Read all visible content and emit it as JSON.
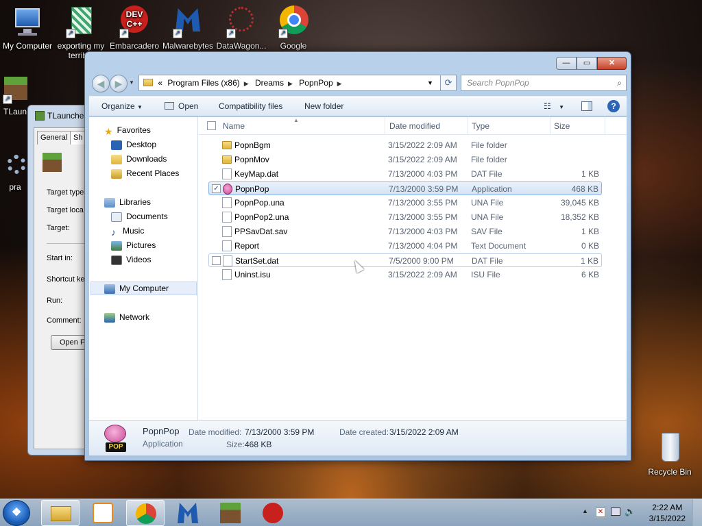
{
  "desktop": {
    "icons": [
      {
        "label": "My Computer"
      },
      {
        "label": "exporting my terrible"
      },
      {
        "label": "Embarcadero"
      },
      {
        "label": "Malwarebytes"
      },
      {
        "label": "DataWagon..."
      },
      {
        "label": "Google"
      },
      {
        "label": "TLaun"
      },
      {
        "label": "pra"
      }
    ],
    "recycle_bin": "Recycle Bin",
    "dev_badge": "DEV",
    "cpp_badge": "C++"
  },
  "bg_window": {
    "title": "TLaunche",
    "tab_general": "General",
    "tab_sh": "Sh",
    "fields": [
      "Target type",
      "Target loca",
      "Target:",
      "Start in:",
      "Shortcut ke",
      "Run:",
      "Comment:"
    ],
    "open_button": "Open F"
  },
  "explorer": {
    "caption": {
      "minimize": "—",
      "maximize": "▭",
      "close": "✕"
    },
    "address": {
      "overflow": "«",
      "crumbs": [
        "Program Files (x86)",
        "Dreams",
        "PopnPop"
      ]
    },
    "search_placeholder": "Search PopnPop",
    "toolbar": {
      "organize": "Organize",
      "open": "Open",
      "compat": "Compatibility files",
      "new_folder": "New folder"
    },
    "nav": {
      "favorites": "Favorites",
      "desktop": "Desktop",
      "downloads": "Downloads",
      "recent": "Recent Places",
      "libraries": "Libraries",
      "documents": "Documents",
      "music": "Music",
      "pictures": "Pictures",
      "videos": "Videos",
      "computer": "My Computer",
      "network": "Network"
    },
    "columns": {
      "name": "Name",
      "date": "Date modified",
      "type": "Type",
      "size": "Size"
    },
    "files": [
      {
        "name": "PopnBgm",
        "date": "3/15/2022 2:09 AM",
        "type": "File folder",
        "size": ""
      },
      {
        "name": "PopnMov",
        "date": "3/15/2022 2:09 AM",
        "type": "File folder",
        "size": ""
      },
      {
        "name": "KeyMap.dat",
        "date": "7/13/2000 4:03 PM",
        "type": "DAT File",
        "size": "1 KB"
      },
      {
        "name": "PopnPop",
        "date": "7/13/2000 3:59 PM",
        "type": "Application",
        "size": "468 KB"
      },
      {
        "name": "PopnPop.una",
        "date": "7/13/2000 3:55 PM",
        "type": "UNA File",
        "size": "39,045 KB"
      },
      {
        "name": "PopnPop2.una",
        "date": "7/13/2000 3:55 PM",
        "type": "UNA File",
        "size": "18,352 KB"
      },
      {
        "name": "PPSavDat.sav",
        "date": "7/13/2000 4:03 PM",
        "type": "SAV File",
        "size": "1 KB"
      },
      {
        "name": "Report",
        "date": "7/13/2000 4:04 PM",
        "type": "Text Document",
        "size": "0 KB"
      },
      {
        "name": "StartSet.dat",
        "date": "7/5/2000 9:00 PM",
        "type": "DAT File",
        "size": "1 KB"
      },
      {
        "name": "Uninst.isu",
        "date": "3/15/2022 2:09 AM",
        "type": "ISU File",
        "size": "6 KB"
      }
    ],
    "details": {
      "name": "PopnPop",
      "kind": "Application",
      "date_modified_label": "Date modified:",
      "date_modified": "7/13/2000 3:59 PM",
      "date_created_label": "Date created:",
      "date_created": "3/15/2022 2:09 AM",
      "size_label": "Size:",
      "size": "468 KB",
      "logo_text": "POP"
    }
  },
  "taskbar": {
    "start_glyph": "❖",
    "time": "2:22 AM",
    "date": "3/15/2022"
  },
  "colors": {
    "selection": "#d4e3f5",
    "accent": "#2c64b6"
  }
}
